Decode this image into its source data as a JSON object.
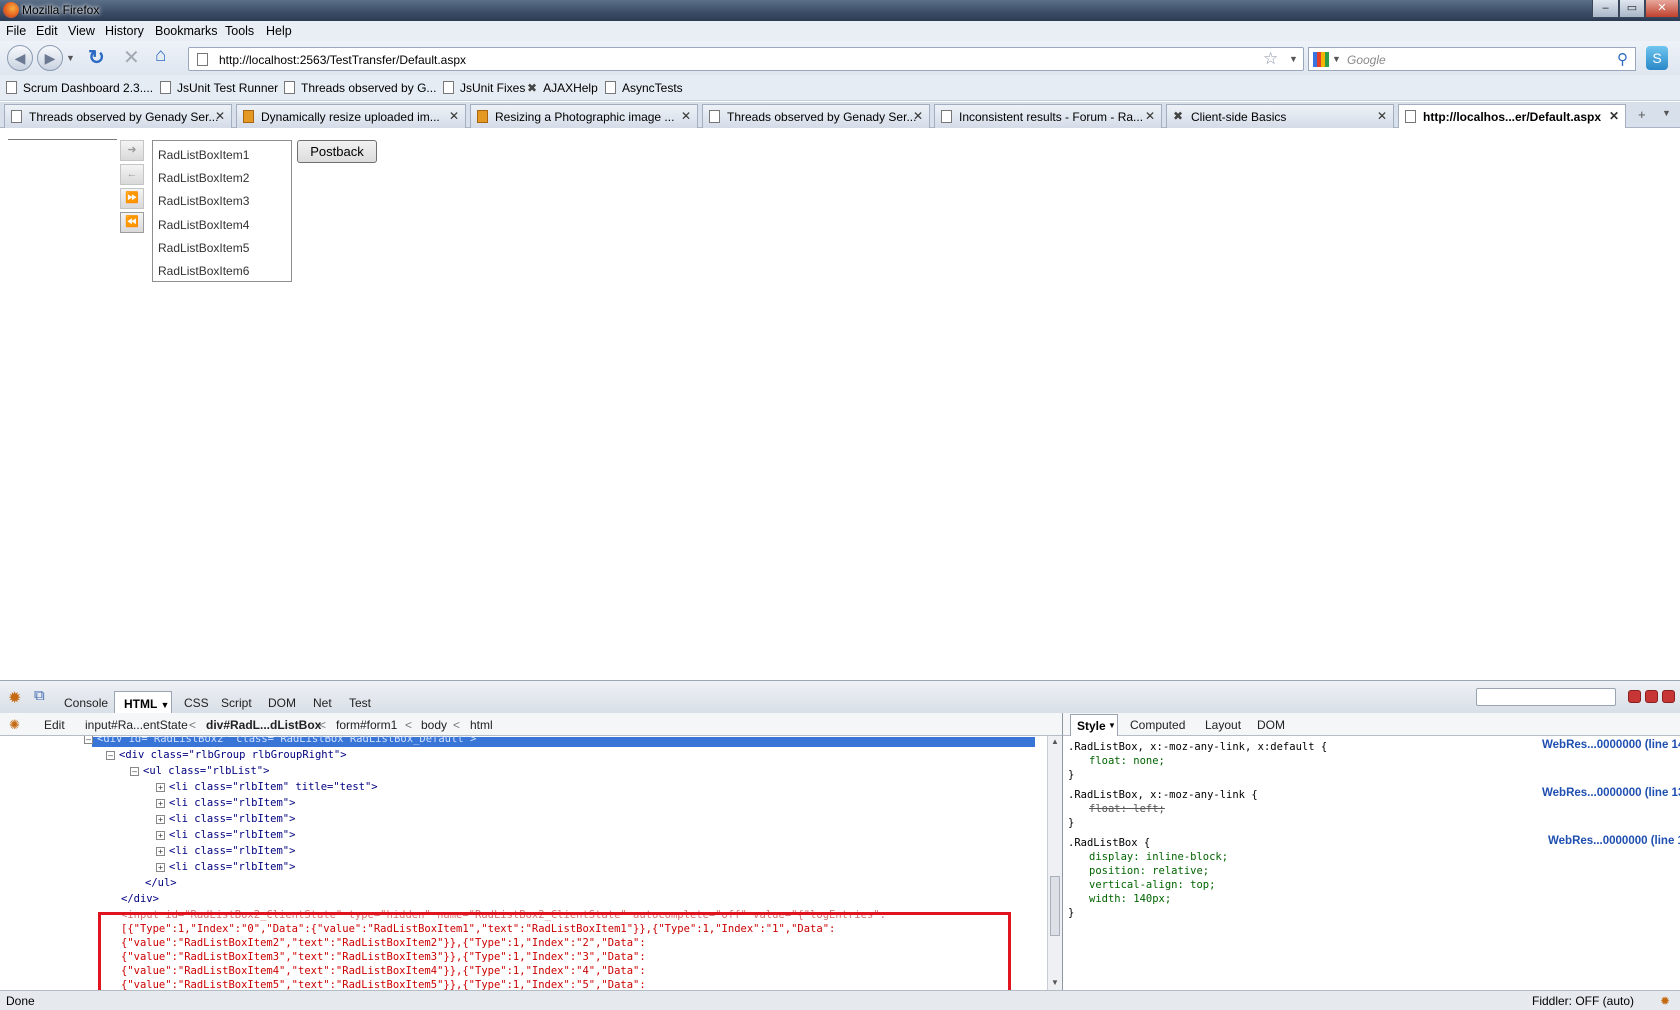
{
  "window": {
    "title": "Mozilla Firefox"
  },
  "menu": [
    "File",
    "Edit",
    "View",
    "History",
    "Bookmarks",
    "Tools",
    "Help"
  ],
  "address": {
    "url": "http://localhost:2563/TestTransfer/Default.aspx"
  },
  "search": {
    "placeholder": "Google"
  },
  "bookmarks": [
    "Scrum Dashboard 2.3....",
    "JsUnit Test Runner",
    "Threads observed by G...",
    "JsUnit Fixes",
    "AJAXHelp",
    "AsyncTests"
  ],
  "tabs": [
    {
      "label": "Threads observed by Genady Ser...",
      "icon": "page"
    },
    {
      "label": "Dynamically resize uploaded im...",
      "icon": "image"
    },
    {
      "label": "Resizing a Photographic image ...",
      "icon": "image"
    },
    {
      "label": "Threads observed by Genady Ser...",
      "icon": "page"
    },
    {
      "label": "Inconsistent results - Forum - Ra...",
      "icon": "page"
    },
    {
      "label": "Client-side Basics",
      "icon": "telerik"
    },
    {
      "label": "http://localhos...er/Default.aspx",
      "icon": "page",
      "active": true
    }
  ],
  "listbox": {
    "items": [
      "RadListBoxItem1",
      "RadListBoxItem2",
      "RadListBoxItem3",
      "RadListBoxItem4",
      "RadListBoxItem5",
      "RadListBoxItem6"
    ]
  },
  "postback": {
    "label": "Postback"
  },
  "firebug": {
    "tabs": [
      "Console",
      "HTML",
      "CSS",
      "Script",
      "DOM",
      "Net",
      "Test"
    ],
    "active_tab": "HTML",
    "edit_label": "Edit",
    "breadcrumbs": [
      "input#Ra...entState",
      "div#RadL...dListBox",
      "form#form1",
      "body",
      "html"
    ],
    "side_tabs": [
      "Style",
      "Computed",
      "Layout",
      "DOM"
    ],
    "html_lines": [
      "<div id=\"RadListBox2\" class=\"RadListBox RadListBox_Default\">",
      "<div class=\"rlbGroup rlbGroupRight\">",
      "<ul class=\"rlbList\">",
      "<li class=\"rlbItem\" title=\"test\">",
      "<li class=\"rlbItem\">",
      "<li class=\"rlbItem\">",
      "<li class=\"rlbItem\">",
      "<li class=\"rlbItem\">",
      "<li class=\"rlbItem\">",
      "</ul>",
      "</div>",
      "<input id=\"RadListBox2_ClientState\" type=\"hidden\" name=\"RadListBox2_ClientState\" autocomplete=\"off\" value=\"{\"logEntries\":",
      "[{\"Type\":1,\"Index\":\"0\",\"Data\":{\"value\":\"RadListBoxItem1\",\"text\":\"RadListBoxItem1\"}},{\"Type\":1,\"Index\":\"1\",\"Data\":",
      "{\"value\":\"RadListBoxItem2\",\"text\":\"RadListBoxItem2\"}},{\"Type\":1,\"Index\":\"2\",\"Data\":",
      "{\"value\":\"RadListBoxItem3\",\"text\":\"RadListBoxItem3\"}},{\"Type\":1,\"Index\":\"3\",\"Data\":",
      "{\"value\":\"RadListBoxItem4\",\"text\":\"RadListBoxItem4\"}},{\"Type\":1,\"Index\":\"4\",\"Data\":",
      "{\"value\":\"RadListBoxItem5\",\"text\":\"RadListBoxItem5\"}},{\"Type\":1,\"Index\":\"5\",\"Data\":"
    ],
    "style_rules": [
      {
        "selector": ".RadListBox, x:-moz-any-link, x:default {",
        "source": "WebRes...0000000 (line 14)",
        "props": [
          "float: none;"
        ],
        "overridden": [
          false
        ]
      },
      {
        "selector": ".RadListBox, x:-moz-any-link {",
        "source": "WebRes...0000000 (line 13)",
        "props": [
          "float: left;"
        ],
        "overridden": [
          true
        ]
      },
      {
        "selector": ".RadListBox {",
        "source": "WebRes...0000000 (line 1)",
        "props": [
          "display: inline-block;",
          "position: relative;",
          "vertical-align: top;",
          "width: 140px;"
        ],
        "overridden": [
          false,
          false,
          false,
          false
        ]
      }
    ],
    "close_brace": "}"
  },
  "status": {
    "left": "Done",
    "right": "Fiddler: OFF (auto)"
  }
}
